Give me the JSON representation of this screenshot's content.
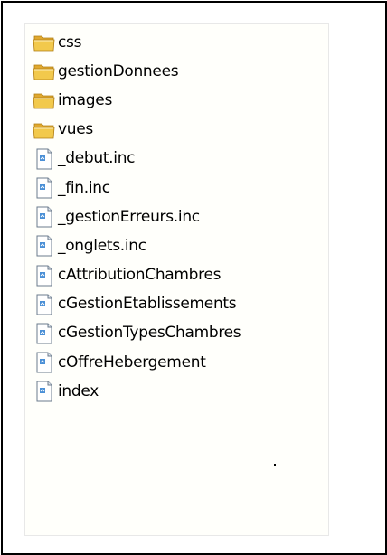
{
  "explorer": {
    "items": [
      {
        "label": "css",
        "icon": "folder-icon"
      },
      {
        "label": "gestionDonnees",
        "icon": "folder-icon"
      },
      {
        "label": "images",
        "icon": "folder-icon"
      },
      {
        "label": "vues",
        "icon": "folder-icon"
      },
      {
        "label": "_debut.inc",
        "icon": "file-icon"
      },
      {
        "label": "_fin.inc",
        "icon": "file-icon"
      },
      {
        "label": "_gestionErreurs.inc",
        "icon": "file-icon"
      },
      {
        "label": "_onglets.inc",
        "icon": "file-icon"
      },
      {
        "label": "cAttributionChambres",
        "icon": "file-icon"
      },
      {
        "label": "cGestionEtablissements",
        "icon": "file-icon"
      },
      {
        "label": "cGestionTypesChambres",
        "icon": "file-icon"
      },
      {
        "label": "cOffreHebergement",
        "icon": "file-icon"
      },
      {
        "label": "index",
        "icon": "file-icon"
      }
    ]
  },
  "colors": {
    "folder_body": "#f2c94c",
    "folder_back": "#e0a82e",
    "file_page": "#ffffff",
    "file_accent": "#4a8fd6"
  }
}
